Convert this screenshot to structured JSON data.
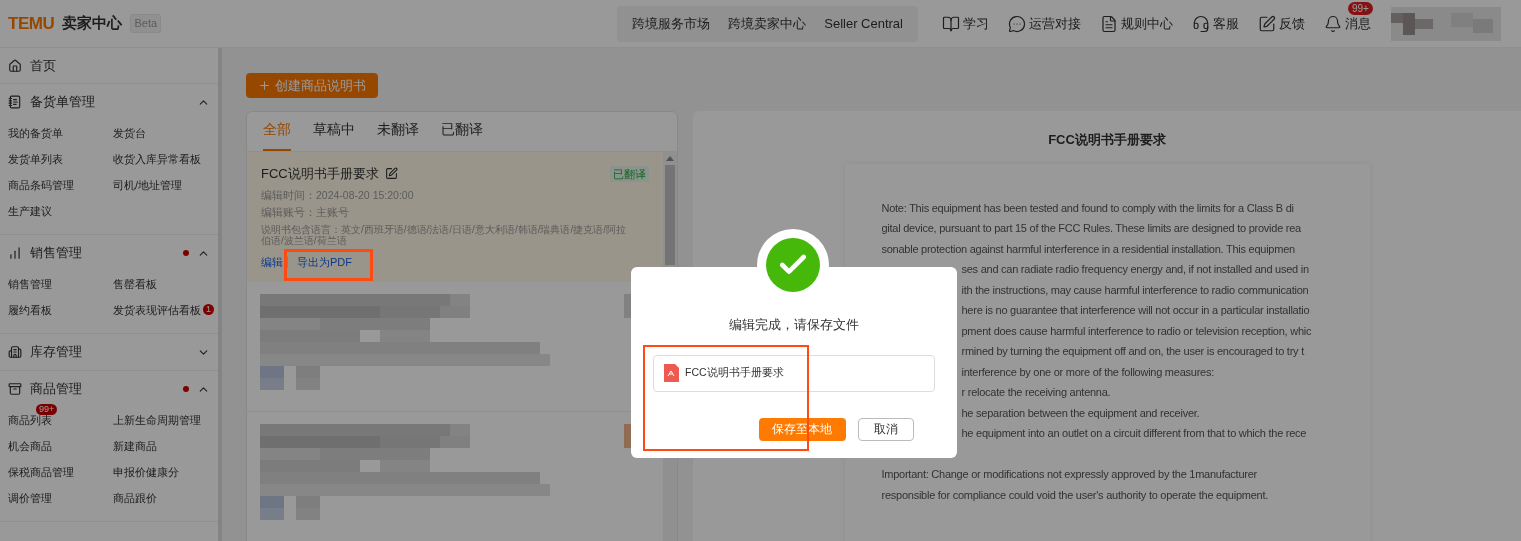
{
  "header": {
    "logo": "TEMU",
    "app_name": "卖家中心",
    "badge": "Beta",
    "nav_group": [
      "跨境服务市场",
      "跨境卖家中心",
      "Seller Central"
    ],
    "nav_items": [
      {
        "kind": "book",
        "label": "学习"
      },
      {
        "kind": "chat",
        "label": "运营对接"
      },
      {
        "kind": "doc",
        "label": "规则中心"
      },
      {
        "kind": "headset",
        "label": "客服"
      },
      {
        "kind": "feedback",
        "label": "反馈"
      },
      {
        "kind": "bell",
        "label": "消息",
        "badge": "99+"
      }
    ]
  },
  "sidebar": {
    "home": "首页",
    "sections": [
      {
        "kind": "orders",
        "title": "备货单管理",
        "expanded": true,
        "dot": false,
        "items": [
          {
            "label": "我的备货单"
          },
          {
            "label": "发货台"
          },
          {
            "label": "发货单列表"
          },
          {
            "label": "收货入库异常看板"
          },
          {
            "label": "商品条码管理"
          },
          {
            "label": "司机/地址管理"
          },
          {
            "label": "生产建议"
          }
        ]
      },
      {
        "kind": "sales",
        "title": "销售管理",
        "expanded": true,
        "dot": true,
        "items": [
          {
            "label": "销售管理"
          },
          {
            "label": "售罄看板"
          },
          {
            "label": "履约看板"
          },
          {
            "label": "发货表现评估看板",
            "badge": "1"
          }
        ]
      },
      {
        "kind": "stock",
        "title": "库存管理",
        "expanded": false,
        "dot": false
      },
      {
        "kind": "goods",
        "title": "商品管理",
        "expanded": true,
        "dot": true,
        "items": [
          {
            "label": "商品列表",
            "badge": "99+"
          },
          {
            "label": "上新生命周期管理"
          },
          {
            "label": "机会商品"
          },
          {
            "label": "新建商品"
          },
          {
            "label": "保税商品管理"
          },
          {
            "label": "申报价健康分"
          },
          {
            "label": "调价管理"
          },
          {
            "label": "商品跟价"
          }
        ]
      }
    ]
  },
  "create_button": "创建商品说明书",
  "tabs": [
    {
      "label": "全部",
      "selected": true
    },
    {
      "label": "草稿中",
      "selected": false
    },
    {
      "label": "未翻译",
      "selected": false
    },
    {
      "label": "已翻译",
      "selected": false
    }
  ],
  "manual": {
    "title": "FCC说明书手册要求",
    "status": "已翻译",
    "edit_time": "编辑时间：2024-08-20 15:20:00",
    "account": "编辑账号：主账号",
    "languages": "说明书包含语言：英文/西班牙语/德语/法语/日语/意大利语/韩语/瑞典语/捷克语/阿拉伯语/波兰语/荷兰语",
    "actions": [
      "编辑",
      "导出为PDF"
    ]
  },
  "preview": {
    "title": "FCC说明书手册要求",
    "lines_before": [
      "Note: This equipment has been tested and found to comply with the limits for a Class B di",
      "gital device, pursuant to part 15 of the FCC Rules. These limits are designed to provide rea",
      "sonable protection against harmful interference in a residential installation. This equipmen"
    ],
    "lines_beside_dialog": [
      "ses and can radiate radio frequency energy and, if not installed and used in",
      "ith the instructions, may cause harmful interference to radio communication",
      "here is no guarantee that interference will not occur in a particular installatio",
      "pment does cause harmful interference to radio or television reception, whic",
      "rmined by turning the equipment off and on, the user is encouraged to try t",
      "interference by one or more of the following measures:",
      "r relocate the receiving antenna.",
      "he separation between the equipment and receiver.",
      "he equipment into an outlet on a circuit different from that to which the rece"
    ],
    "lines_after": [
      "Important: Change or modifications not expressly approved by the 1manufacturer",
      "responsible for compliance could void the user's authority to operate the equipment."
    ]
  },
  "dialog": {
    "message": "编辑完成，请保存文件",
    "file_name": "FCC说明书手册要求",
    "save_button": "保存至本地",
    "cancel_button": "取消"
  }
}
